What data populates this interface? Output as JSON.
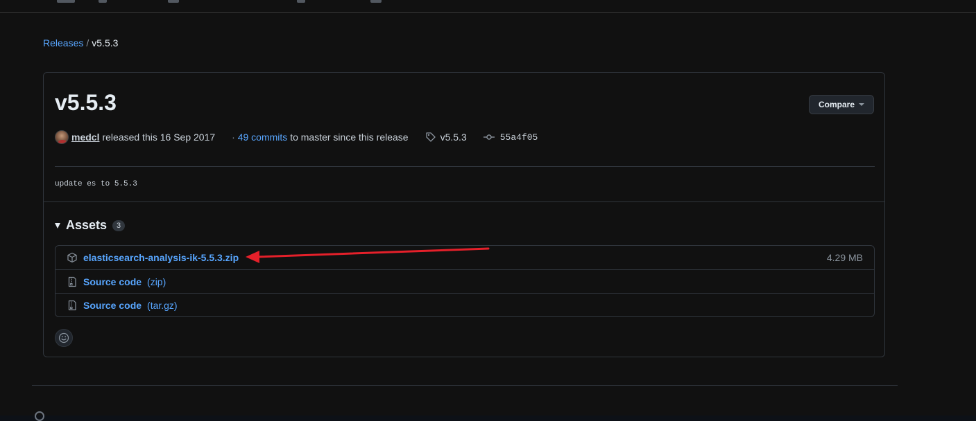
{
  "breadcrumb": {
    "releases_label": "Releases",
    "separator": "/",
    "current": "v5.5.3"
  },
  "release": {
    "title": "v5.5.3",
    "compare_label": "Compare",
    "author": "medcl",
    "released_text": "released this 16 Sep 2017",
    "commits_prefix": "·",
    "commits_link": "49 commits",
    "commits_rest": "to master since this release",
    "tag": "v5.5.3",
    "commit_sha": "55a4f05",
    "body": "update es to 5.5.3"
  },
  "assets": {
    "title": "Assets",
    "count": "3",
    "items": [
      {
        "name": "elasticsearch-analysis-ik-5.5.3.zip",
        "format": "",
        "size": "4.29 MB",
        "icon": "package-icon"
      },
      {
        "name": "Source code",
        "format": "(zip)",
        "size": "",
        "icon": "file-zip-icon"
      },
      {
        "name": "Source code",
        "format": "(tar.gz)",
        "size": "",
        "icon": "file-zip-icon"
      }
    ]
  },
  "annotation": {
    "arrow_color": "#e5202a"
  },
  "colors": {
    "link": "#58a6ff",
    "background": "#111111",
    "border": "#30363d"
  }
}
